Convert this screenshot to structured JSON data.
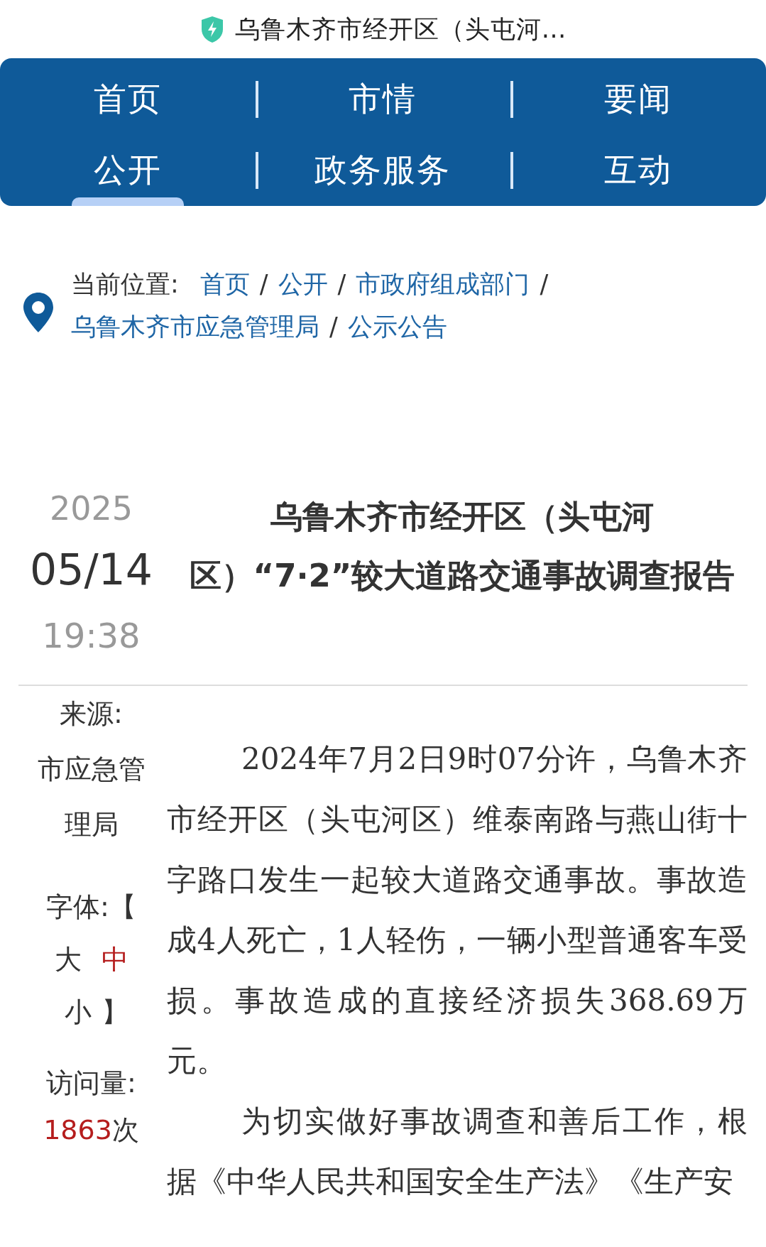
{
  "header": {
    "title": "乌鲁木齐市经开区（头屯河…"
  },
  "nav": {
    "items": [
      {
        "label": "首页",
        "selected": false
      },
      {
        "label": "市情",
        "selected": false
      },
      {
        "label": "要闻",
        "selected": false
      },
      {
        "label": "公开",
        "selected": true
      },
      {
        "label": "政务服务",
        "selected": false
      },
      {
        "label": "互动",
        "selected": false
      }
    ]
  },
  "breadcrumb": {
    "label": "当前位置:",
    "items": [
      "首页",
      "公开",
      "市政府组成部门",
      "乌鲁木齐市应急管理局",
      "公示公告"
    ],
    "separators": [
      "/",
      "/",
      "/",
      "/"
    ]
  },
  "article": {
    "date": {
      "year": "2025",
      "day": "05/14",
      "time": "19:38"
    },
    "title": "乌鲁木齐市经开区（头屯河区）“7·2”较大道路交通事故调查报告",
    "source": {
      "label": "来源:",
      "value": "市应急管理局"
    },
    "font_size": {
      "label": "字体:【",
      "options": [
        {
          "label": "大",
          "selected": false
        },
        {
          "label": "中",
          "selected": true
        },
        {
          "label": "小",
          "selected": false
        }
      ],
      "close": "】"
    },
    "views": {
      "label": "访问量:",
      "count": "1863",
      "unit": "次"
    },
    "paragraphs": [
      "2024年7月2日9时07分许，乌鲁木齐市经开区（头屯河区）维泰南路与燕山街十字路口发生一起较大道路交通事故。事故造成4人死亡，1人轻伤，一辆小型普通客车受损。事故造成的直接经济损失368.69万元。",
      "为切实做好事故调查和善后工作，根据《中华人民共和国安全生产法》《生产安"
    ]
  }
}
